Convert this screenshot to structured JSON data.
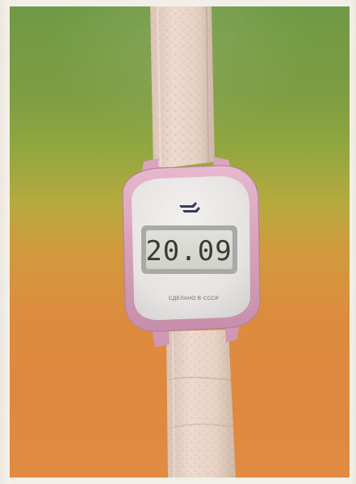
{
  "image": {
    "subject": "Soviet digital wristwatch photo",
    "watch": {
      "time_display": "20.09",
      "caption": "СДЕЛАНО В СССР",
      "logo_icon": "factory-logo-icon"
    },
    "colors": {
      "background_top": "#6f9a45",
      "background_bottom": "#e08a42",
      "case": "#d9a8c1",
      "dial": "#e9e7e7",
      "lcd": "#d8dbd4",
      "strap": "#ead7c9"
    }
  }
}
